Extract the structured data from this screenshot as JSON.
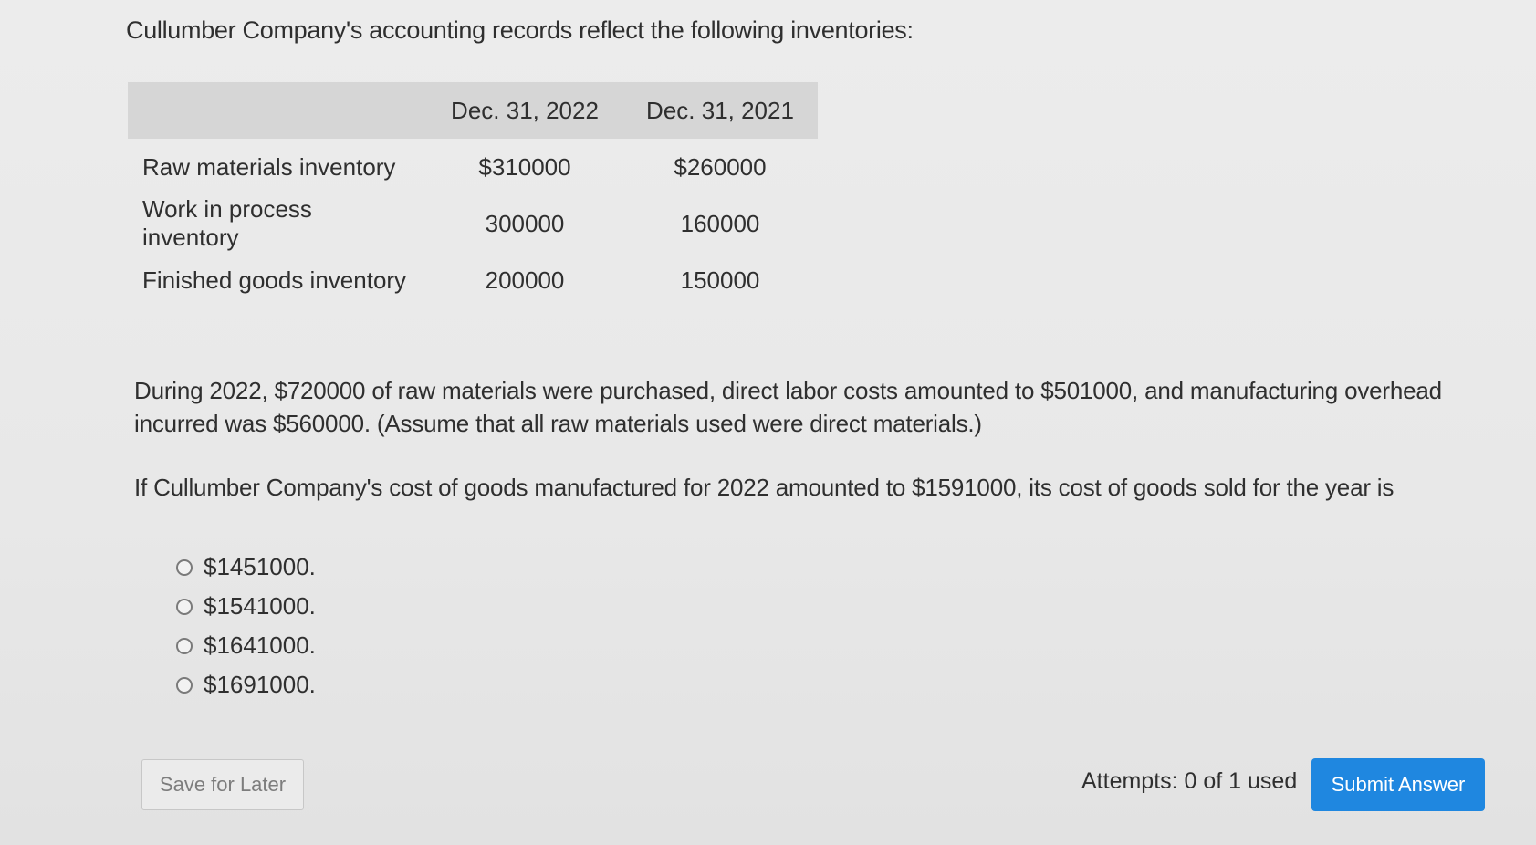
{
  "question": {
    "intro": "Cullumber Company's accounting records reflect the following inventories:",
    "table": {
      "headers": [
        "",
        "Dec. 31, 2022",
        "Dec. 31, 2021"
      ],
      "rows": [
        {
          "label": "Raw materials inventory",
          "values": [
            "$310000",
            "$260000"
          ]
        },
        {
          "label": "Work in process inventory",
          "values": [
            "300000",
            "160000"
          ]
        },
        {
          "label": "Finished goods inventory",
          "values": [
            "200000",
            "150000"
          ]
        }
      ]
    },
    "paragraph1": "During 2022, $720000 of raw materials were purchased, direct labor costs amounted to $501000, and manufacturing overhead incurred was $560000. (Assume that all raw materials used were direct materials.)",
    "paragraph2": "If Cullumber Company's cost of goods manufactured for 2022 amounted to $1591000, its cost of goods sold for the year is",
    "options": [
      "$1451000.",
      "$1541000.",
      "$1641000.",
      "$1691000."
    ]
  },
  "footer": {
    "save_label": "Save for Later",
    "attempts_text": "Attempts: 0 of 1 used",
    "submit_label": "Submit Answer"
  },
  "colors": {
    "submit_bg": "#1f87e0",
    "table_header_bg": "#d6d6d6"
  }
}
